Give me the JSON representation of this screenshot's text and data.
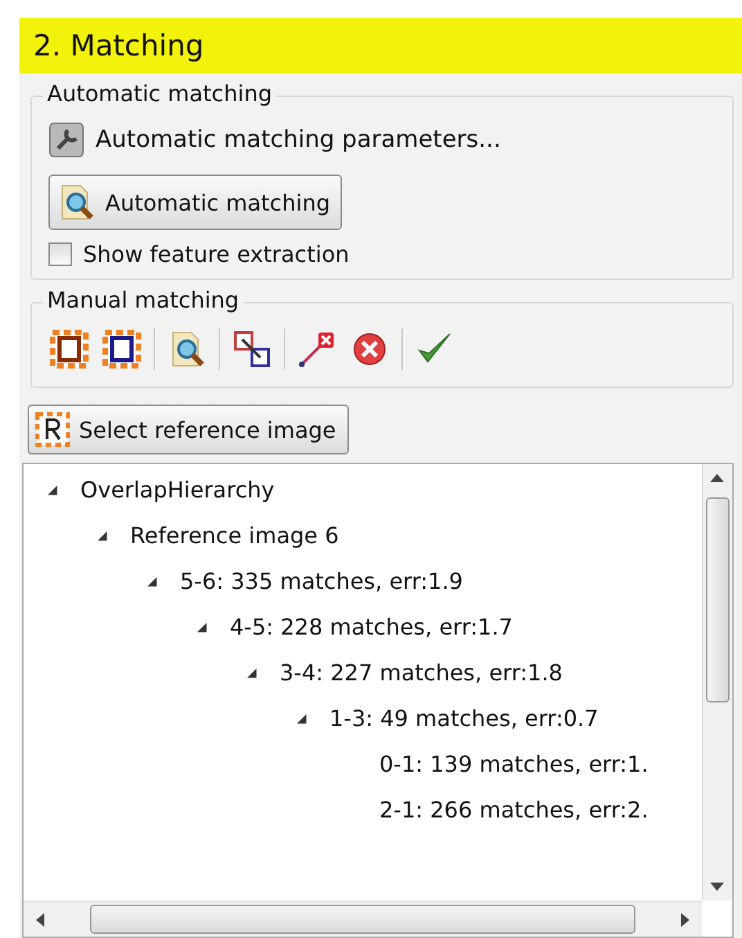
{
  "header": {
    "title": "2. Matching"
  },
  "automatic_group": {
    "title": "Automatic matching",
    "parameters_link": "Automatic matching parameters...",
    "button": "Automatic matching",
    "checkbox": {
      "label": "Show feature extraction",
      "checked": false
    }
  },
  "manual_group": {
    "title": "Manual matching",
    "tools": [
      {
        "kind": "one"
      },
      {
        "kind": "two"
      },
      {
        "kind": "sep"
      },
      {
        "kind": "zoom"
      },
      {
        "kind": "sep"
      },
      {
        "kind": "link"
      },
      {
        "kind": "sep"
      },
      {
        "kind": "unlink"
      },
      {
        "kind": "delete"
      },
      {
        "kind": "sep"
      },
      {
        "kind": "accept"
      }
    ]
  },
  "select_button": "Select reference image",
  "tree": [
    {
      "label": "OverlapHierarchy",
      "expanded": true,
      "children": [
        {
          "label": "Reference image 6",
          "expanded": true,
          "children": [
            {
              "label": "5-6: 335 matches, err:1.9",
              "expanded": true,
              "children": [
                {
                  "label": "4-5: 228 matches, err:1.7",
                  "expanded": true,
                  "children": [
                    {
                      "label": "3-4: 227 matches, err:1.8",
                      "expanded": true,
                      "children": [
                        {
                          "label": "1-3: 49 matches, err:0.7",
                          "expanded": true,
                          "children": [
                            {
                              "label": "0-1: 139 matches, err:1."
                            },
                            {
                              "label": "2-1: 266 matches, err:2."
                            }
                          ]
                        }
                      ]
                    }
                  ]
                }
              ]
            }
          ]
        }
      ]
    }
  ]
}
